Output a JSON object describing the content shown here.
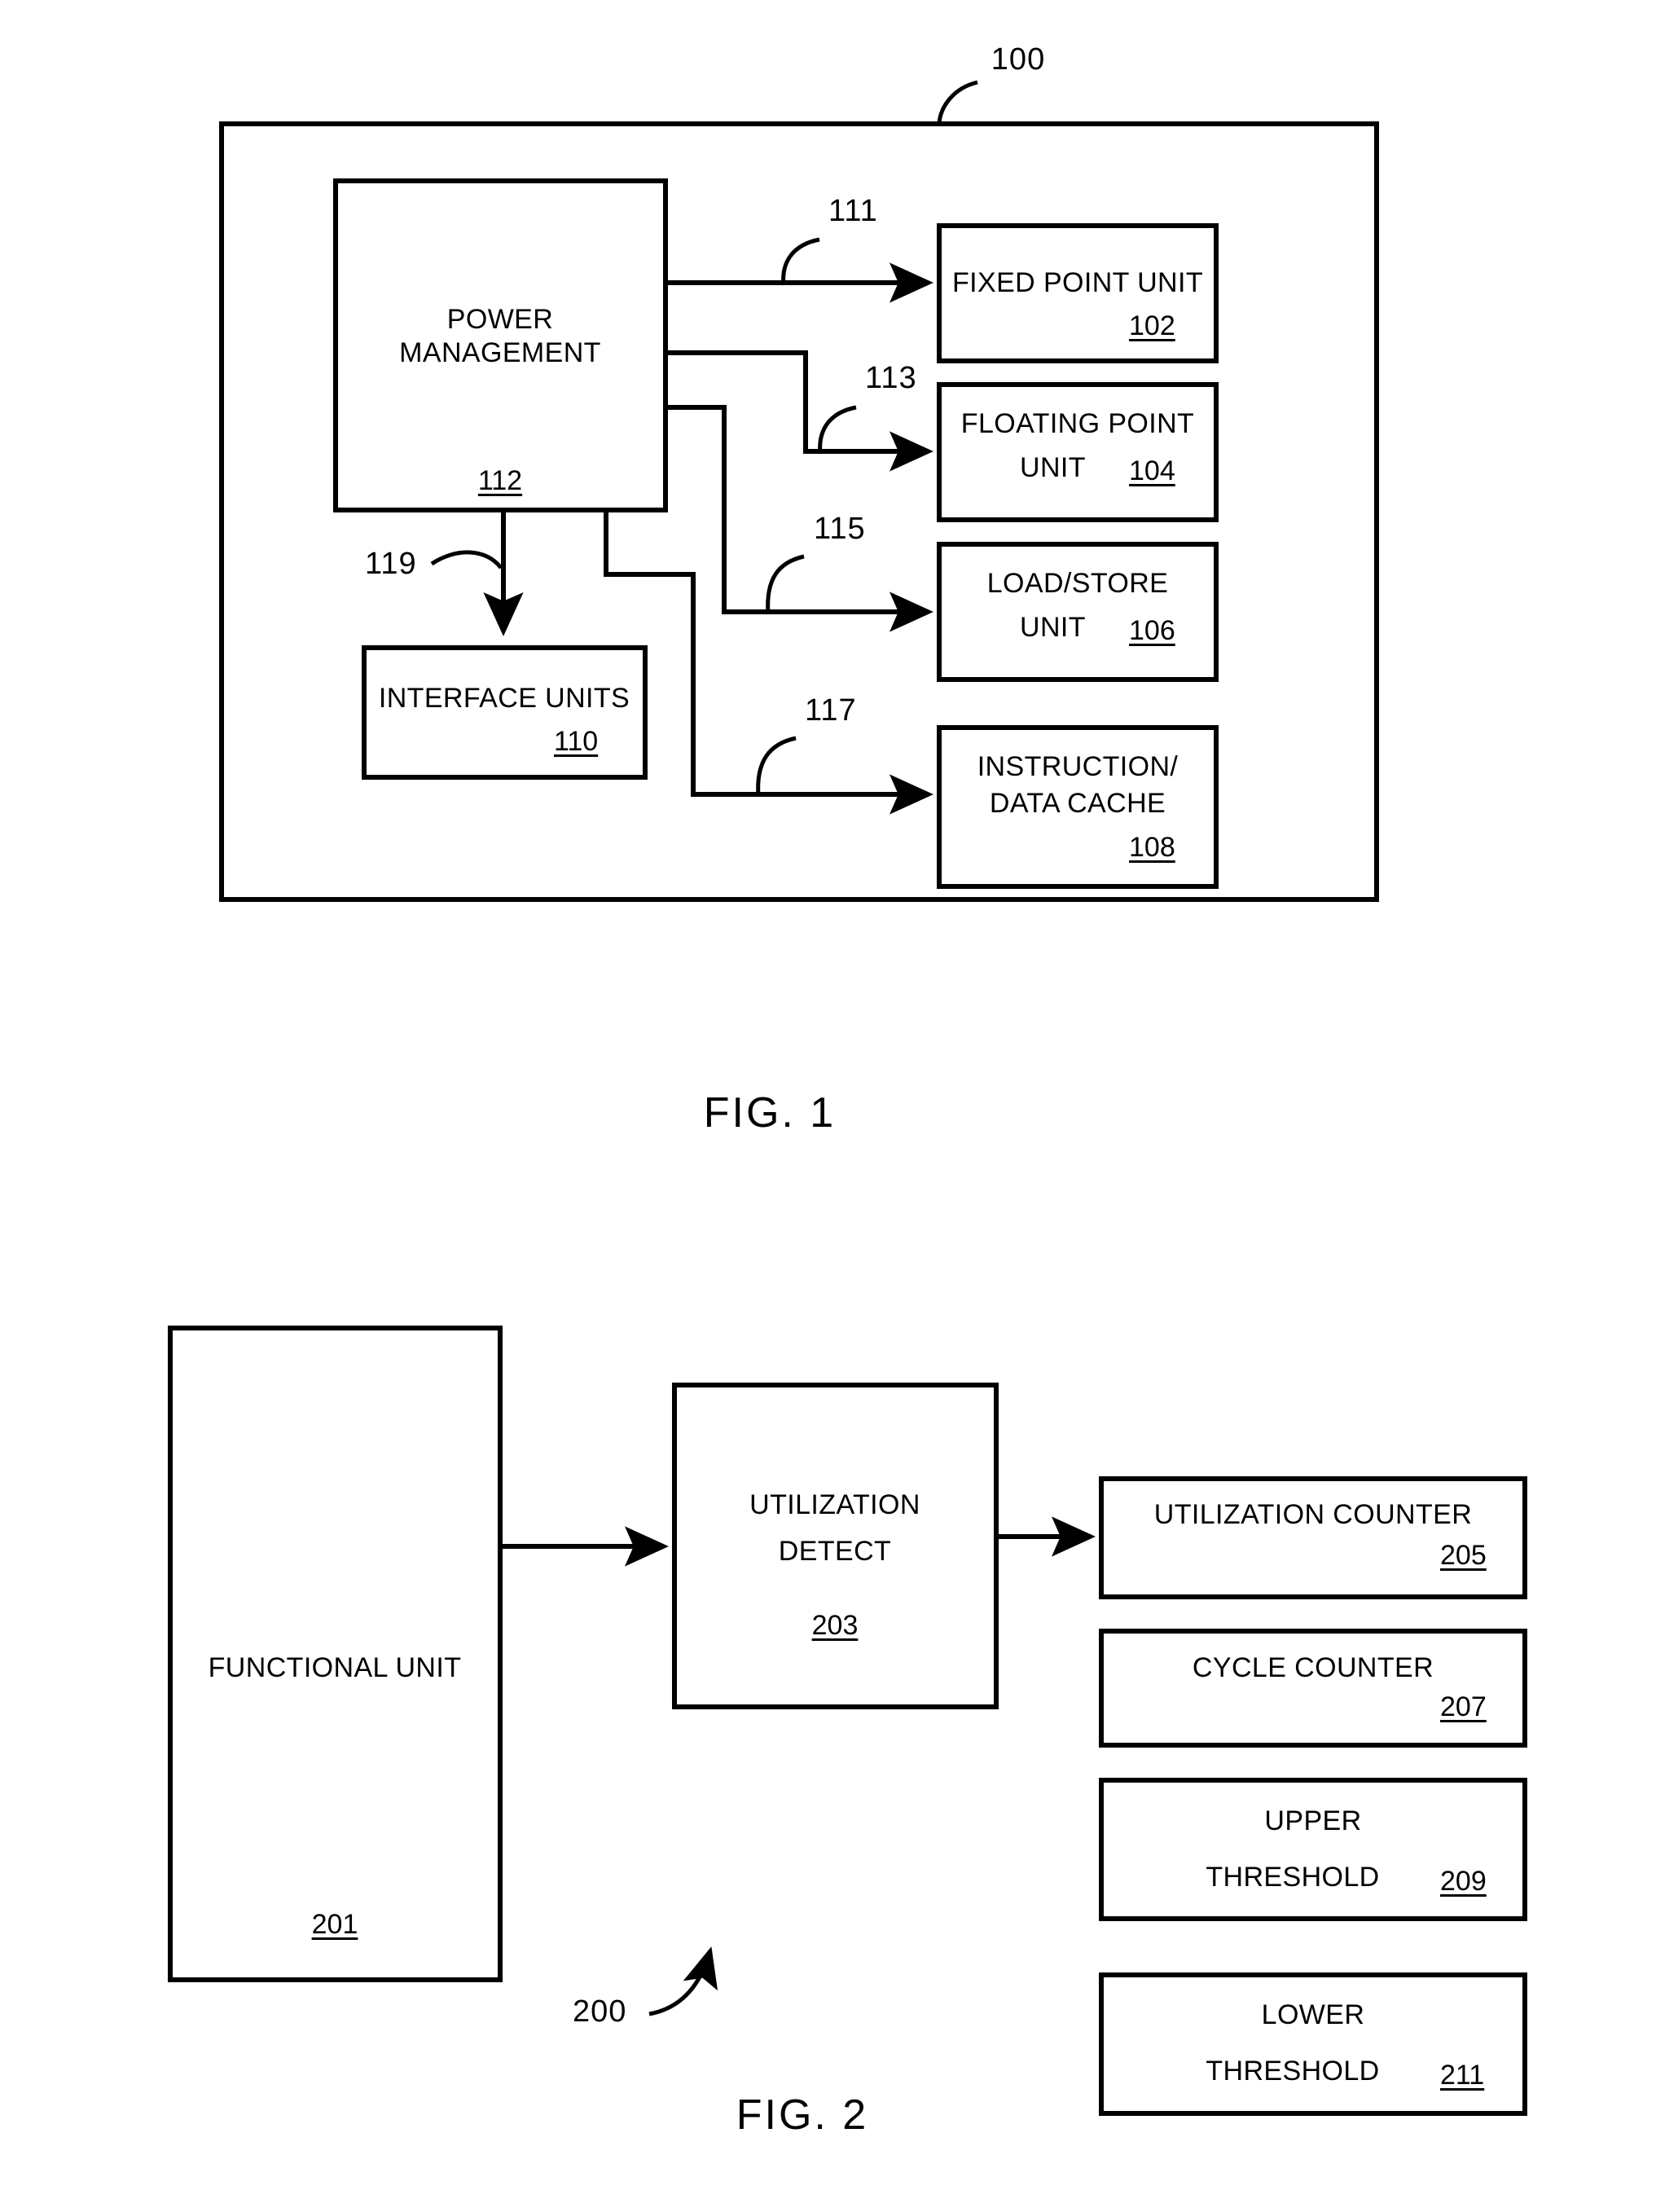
{
  "document": {
    "type": "patent-drawing-sheet",
    "background_color": "#ffffff",
    "line_color": "#000000"
  },
  "figures": [
    {
      "caption": "FIG. 1",
      "system_ref": "100",
      "blocks": [
        {
          "id": "power-management",
          "label_lines": [
            "POWER",
            "MANAGEMENT"
          ],
          "ref": "112"
        },
        {
          "id": "fixed-point-unit",
          "label_lines": [
            "FIXED POINT UNIT"
          ],
          "ref": "102"
        },
        {
          "id": "floating-point-unit",
          "label_lines": [
            "FLOATING POINT",
            "UNIT"
          ],
          "ref": "104"
        },
        {
          "id": "load-store-unit",
          "label_lines": [
            "LOAD/STORE",
            "UNIT"
          ],
          "ref": "106"
        },
        {
          "id": "instruction-data-cache",
          "label_lines": [
            "INSTRUCTION/",
            "DATA CACHE"
          ],
          "ref": "108"
        },
        {
          "id": "interface-units",
          "label_lines": [
            "INTERFACE UNITS"
          ],
          "ref": "110"
        }
      ],
      "connectors": [
        {
          "id": "pm-to-fixed-point",
          "ref": "111"
        },
        {
          "id": "pm-to-floating-point",
          "ref": "113"
        },
        {
          "id": "pm-to-load-store",
          "ref": "115"
        },
        {
          "id": "pm-to-instruction-data-cache",
          "ref": "117"
        },
        {
          "id": "pm-to-interface-units",
          "ref": "119"
        }
      ]
    },
    {
      "caption": "FIG. 2",
      "system_ref": "200",
      "blocks": [
        {
          "id": "functional-unit",
          "label_lines": [
            "FUNCTIONAL UNIT"
          ],
          "ref": "201"
        },
        {
          "id": "utilization-detect",
          "label_lines": [
            "UTILIZATION",
            "DETECT"
          ],
          "ref": "203"
        },
        {
          "id": "utilization-counter",
          "label_lines": [
            "UTILIZATION COUNTER"
          ],
          "ref": "205"
        },
        {
          "id": "cycle-counter",
          "label_lines": [
            "CYCLE COUNTER"
          ],
          "ref": "207"
        },
        {
          "id": "upper-threshold",
          "label_lines": [
            "UPPER",
            "THRESHOLD"
          ],
          "ref": "209"
        },
        {
          "id": "lower-threshold",
          "label_lines": [
            "LOWER",
            "THRESHOLD"
          ],
          "ref": "211"
        }
      ]
    }
  ],
  "fig1": {
    "caption": "FIG. 1",
    "ref_100": "100",
    "ref_111": "111",
    "ref_113": "113",
    "ref_115": "115",
    "ref_117": "117",
    "ref_119": "119",
    "power_management": {
      "line1": "POWER",
      "line2": "MANAGEMENT",
      "ref": "112"
    },
    "fixed_point_unit": {
      "line1": "FIXED POINT UNIT",
      "ref": "102"
    },
    "floating_point_unit": {
      "line1": "FLOATING POINT",
      "line2": "UNIT",
      "ref": "104"
    },
    "load_store_unit": {
      "line1": "LOAD/STORE",
      "line2": "UNIT",
      "ref": "106"
    },
    "instruction_data_cache": {
      "line1": "INSTRUCTION/",
      "line2": "DATA CACHE",
      "ref": "108"
    },
    "interface_units": {
      "line1": "INTERFACE UNITS",
      "ref": "110"
    }
  },
  "fig2": {
    "caption": "FIG. 2",
    "ref_200": "200",
    "functional_unit": {
      "line1": "FUNCTIONAL UNIT",
      "ref": "201"
    },
    "utilization_detect": {
      "line1": "UTILIZATION",
      "line2": "DETECT",
      "ref": "203"
    },
    "utilization_counter": {
      "line1": "UTILIZATION COUNTER",
      "ref": "205"
    },
    "cycle_counter": {
      "line1": "CYCLE COUNTER",
      "ref": "207"
    },
    "upper_threshold": {
      "line1": "UPPER",
      "line2": "THRESHOLD",
      "ref": "209"
    },
    "lower_threshold": {
      "line1": "LOWER",
      "line2": "THRESHOLD",
      "ref": "211"
    }
  }
}
